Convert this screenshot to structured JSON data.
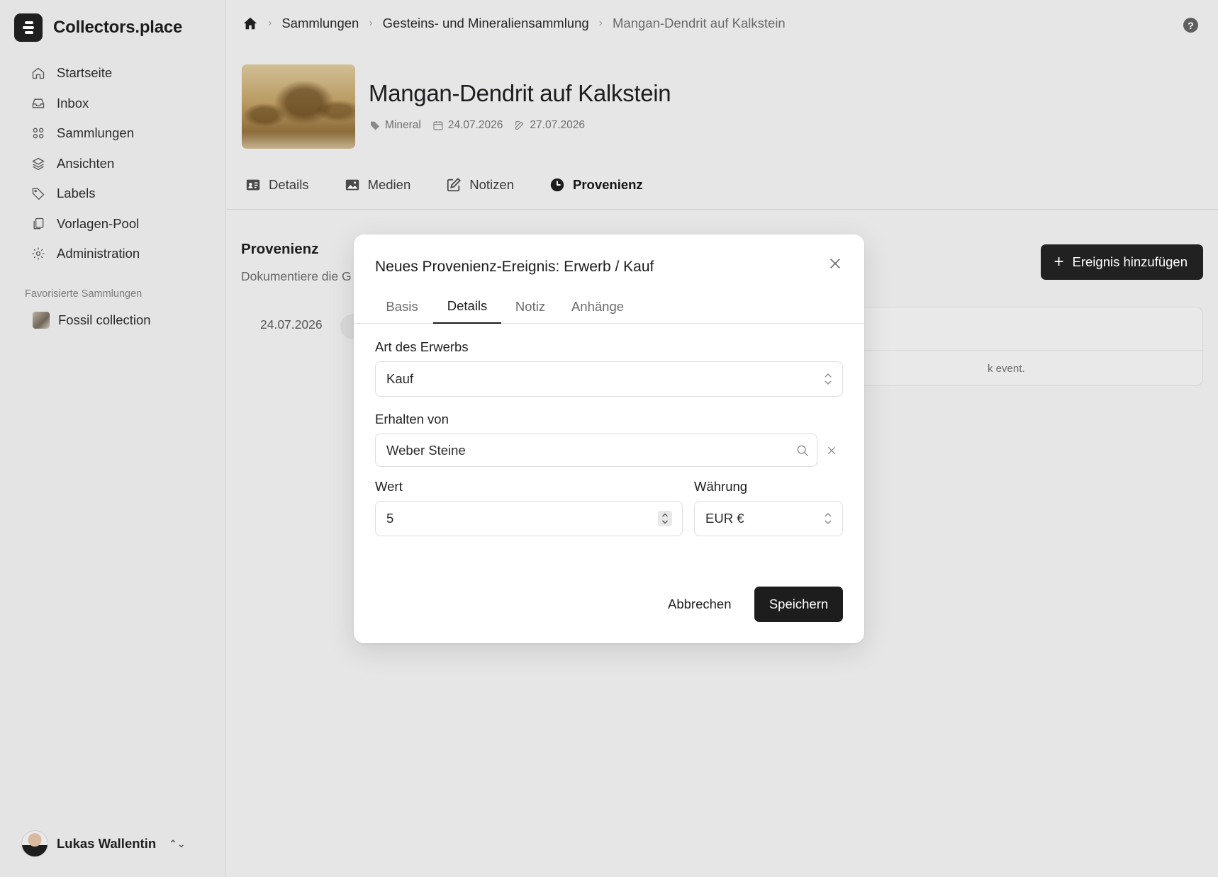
{
  "app": {
    "name": "Collectors.place"
  },
  "sidebar": {
    "items": [
      {
        "label": "Startseite",
        "icon": "home-icon"
      },
      {
        "label": "Inbox",
        "icon": "inbox-icon"
      },
      {
        "label": "Sammlungen",
        "icon": "grid-icon"
      },
      {
        "label": "Ansichten",
        "icon": "layers-icon"
      },
      {
        "label": "Labels",
        "icon": "tag-icon"
      },
      {
        "label": "Vorlagen-Pool",
        "icon": "copy-icon"
      },
      {
        "label": "Administration",
        "icon": "gear-icon"
      }
    ],
    "favorites_heading": "Favorisierte Sammlungen",
    "favorites": [
      {
        "label": "Fossil collection"
      }
    ],
    "user": {
      "name": "Lukas Wallentin"
    }
  },
  "breadcrumb": {
    "items": [
      "Sammlungen",
      "Gesteins- und Mineraliensammlung"
    ],
    "current": "Mangan-Dendrit auf Kalkstein"
  },
  "item": {
    "title": "Mangan-Dendrit auf Kalkstein",
    "type": "Mineral",
    "created": "24.07.2026",
    "modified": "27.07.2026"
  },
  "tabs": [
    {
      "label": "Details",
      "icon": "id-card-icon"
    },
    {
      "label": "Medien",
      "icon": "image-icon"
    },
    {
      "label": "Notizen",
      "icon": "edit-icon"
    },
    {
      "label": "Provenienz",
      "icon": "clock-icon",
      "active": true
    }
  ],
  "provenance": {
    "title": "Provenienz",
    "description": "Dokumentiere die G",
    "add_button": "Ereignis hinzufügen",
    "event_date": "24.07.2026",
    "card_text": "k event."
  },
  "modal": {
    "title": "Neues Provenienz-Ereignis: Erwerb / Kauf",
    "tabs": [
      "Basis",
      "Details",
      "Notiz",
      "Anhänge"
    ],
    "active_tab": "Details",
    "acquisition_label": "Art des Erwerbs",
    "acquisition_value": "Kauf",
    "received_label": "Erhalten von",
    "received_value": "Weber Steine",
    "value_label": "Wert",
    "value": "5",
    "currency_label": "Währung",
    "currency_value": "EUR €",
    "cancel": "Abbrechen",
    "save": "Speichern"
  }
}
